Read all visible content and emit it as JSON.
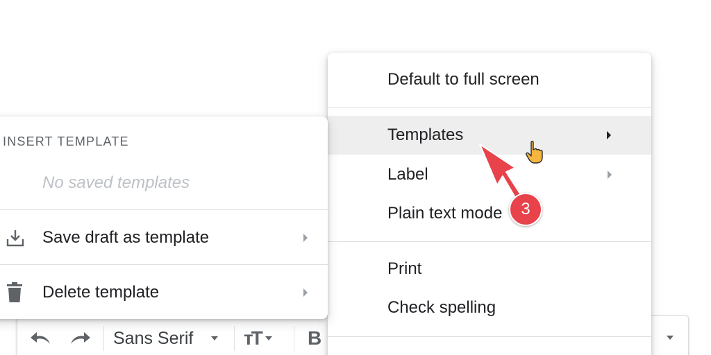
{
  "toolbar": {
    "font_label": "Sans Serif",
    "size_glyph": "тТ",
    "bold_glyph": "B",
    "icons": [
      "undo-icon",
      "redo-icon",
      "text-size-icon",
      "bold-icon",
      "chevron-down-icon"
    ]
  },
  "main_menu": {
    "items": [
      {
        "label": "Default to full screen"
      },
      {
        "label": "Templates",
        "submenu": true,
        "highlighted": true
      },
      {
        "label": "Label",
        "submenu": true
      },
      {
        "label": "Plain text mode"
      },
      {
        "label": "Print"
      },
      {
        "label": "Check spelling"
      }
    ]
  },
  "template_menu": {
    "header": "INSERT TEMPLATE",
    "empty_text": "No saved templates",
    "items": [
      {
        "label": "Save draft as template",
        "icon": "download-icon",
        "submenu": true
      },
      {
        "label": "Delete template",
        "icon": "trash-icon",
        "submenu": true
      }
    ]
  },
  "annotation": {
    "step_number": "3",
    "color": "#e8424a"
  },
  "colors": {
    "hover_background": "#eeeeee",
    "divider": "#e0e0e0",
    "muted_text": "#bdc1c6"
  }
}
